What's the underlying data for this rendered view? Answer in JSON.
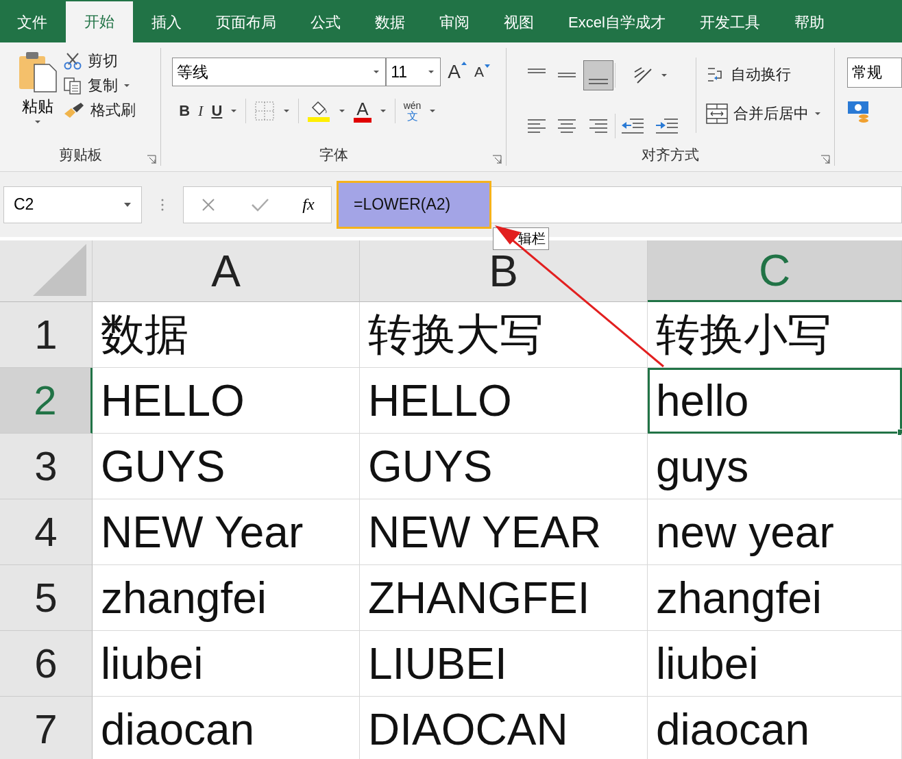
{
  "tabs": [
    {
      "label": "文件",
      "selected": false
    },
    {
      "label": "开始",
      "selected": true
    },
    {
      "label": "插入",
      "selected": false
    },
    {
      "label": "页面布局",
      "selected": false
    },
    {
      "label": "公式",
      "selected": false
    },
    {
      "label": "数据",
      "selected": false
    },
    {
      "label": "审阅",
      "selected": false
    },
    {
      "label": "视图",
      "selected": false
    },
    {
      "label": "Excel自学成才",
      "selected": false
    },
    {
      "label": "开发工具",
      "selected": false
    },
    {
      "label": "帮助",
      "selected": false
    }
  ],
  "clipboard": {
    "paste": "粘贴",
    "cut": "剪切",
    "copy": "复制",
    "format_painter": "格式刷",
    "label": "剪贴板"
  },
  "font": {
    "name": "等线",
    "size": "11",
    "grow": "A",
    "shrink": "A",
    "bold": "B",
    "italic": "I",
    "underline": "U",
    "font_color": "A",
    "phonetic_top": "wén",
    "phonetic_bottom": "文",
    "label": "字体"
  },
  "alignment": {
    "wrap_text": "自动换行",
    "merge_center": "合并后居中",
    "label": "对齐方式"
  },
  "number": {
    "format": "常规"
  },
  "formula_bar": {
    "name_box": "C2",
    "fx": "fx",
    "formula": "=LOWER(A2)",
    "tooltip": "辑栏"
  },
  "columns": [
    {
      "label": "A",
      "selected": false
    },
    {
      "label": "B",
      "selected": false
    },
    {
      "label": "C",
      "selected": true
    }
  ],
  "rows": [
    {
      "number": "1",
      "selected": false,
      "cells": [
        {
          "text": "数据",
          "selected": false
        },
        {
          "text": "转换大写",
          "selected": false
        },
        {
          "text": "转换小写",
          "selected": false
        }
      ]
    },
    {
      "number": "2",
      "selected": true,
      "cells": [
        {
          "text": "HELLO",
          "selected": false
        },
        {
          "text": "HELLO",
          "selected": false
        },
        {
          "text": "hello",
          "selected": true
        }
      ]
    },
    {
      "number": "3",
      "selected": false,
      "cells": [
        {
          "text": "GUYS",
          "selected": false
        },
        {
          "text": "GUYS",
          "selected": false
        },
        {
          "text": "guys",
          "selected": false
        }
      ]
    },
    {
      "number": "4",
      "selected": false,
      "cells": [
        {
          "text": "NEW Year",
          "selected": false
        },
        {
          "text": "NEW YEAR",
          "selected": false
        },
        {
          "text": "new year",
          "selected": false
        }
      ]
    },
    {
      "number": "5",
      "selected": false,
      "cells": [
        {
          "text": "zhangfei",
          "selected": false
        },
        {
          "text": "ZHANGFEI",
          "selected": false
        },
        {
          "text": "zhangfei",
          "selected": false
        }
      ]
    },
    {
      "number": "6",
      "selected": false,
      "cells": [
        {
          "text": "liubei",
          "selected": false
        },
        {
          "text": "LIUBEI",
          "selected": false
        },
        {
          "text": "liubei",
          "selected": false
        }
      ]
    },
    {
      "number": "7",
      "selected": false,
      "cells": [
        {
          "text": "diaocan",
          "selected": false
        },
        {
          "text": "DIAOCAN",
          "selected": false
        },
        {
          "text": "diaocan",
          "selected": false
        }
      ]
    }
  ]
}
